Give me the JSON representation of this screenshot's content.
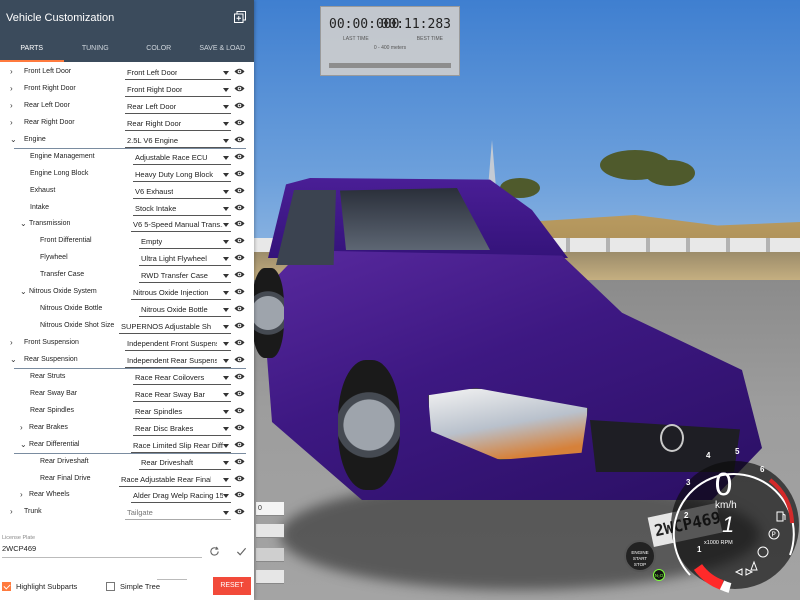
{
  "panel": {
    "title": "Vehicle Customization",
    "tabs": [
      {
        "label": "PARTS",
        "active": true
      },
      {
        "label": "TUNING",
        "active": false
      },
      {
        "label": "COLOR",
        "active": false
      },
      {
        "label": "SAVE & LOAD",
        "active": false
      }
    ],
    "accent": "#ff7a3d"
  },
  "parts": [
    {
      "label": "Front Left Door",
      "value": "Front Left Door"
    },
    {
      "label": "Front Right Door",
      "value": "Front Right Door"
    },
    {
      "label": "Rear Left Door",
      "value": "Rear Left Door"
    },
    {
      "label": "Rear Right Door",
      "value": "Rear Right Door"
    },
    {
      "label": "Engine",
      "value": "2.5L V6 Engine"
    },
    {
      "label": "Engine Management",
      "value": "Adjustable Race ECU"
    },
    {
      "label": "Engine Long Block",
      "value": "Heavy Duty Long Block"
    },
    {
      "label": "Exhaust",
      "value": "V6 Exhaust"
    },
    {
      "label": "Intake",
      "value": "Stock Intake"
    },
    {
      "label": "Transmission",
      "value": "V6 5-Speed Manual Trans..."
    },
    {
      "label": "Front Differential",
      "value": "Empty"
    },
    {
      "label": "Flywheel",
      "value": "Ultra Light Flywheel"
    },
    {
      "label": "Transfer Case",
      "value": "RWD Transfer Case"
    },
    {
      "label": "Nitrous Oxide System",
      "value": "Nitrous Oxide Injection"
    },
    {
      "label": "Nitrous Oxide Bottle",
      "value": "Nitrous Oxide Bottle"
    },
    {
      "label": "Nitrous Oxide Shot Size",
      "value": "SUPERNOS Adjustable Shot Size"
    },
    {
      "label": "Front Suspension",
      "value": "Independent Front Suspension"
    },
    {
      "label": "Rear Suspension",
      "value": "Independent Rear Suspension"
    },
    {
      "label": "Rear Struts",
      "value": "Race Rear Coilovers"
    },
    {
      "label": "Rear Sway Bar",
      "value": "Race Rear Sway Bar"
    },
    {
      "label": "Rear Spindles",
      "value": "Rear Spindles"
    },
    {
      "label": "Rear Brakes",
      "value": "Rear Disc Brakes"
    },
    {
      "label": "Rear Differential",
      "value": "Race Limited Slip Rear Diff..."
    },
    {
      "label": "Rear Driveshaft",
      "value": "Rear Driveshaft"
    },
    {
      "label": "Rear Final Drive",
      "value": "Race Adjustable Rear Final Drive"
    },
    {
      "label": "Rear Wheels",
      "value": "Alder Drag Welp Racing 15..."
    },
    {
      "label": "Trunk",
      "value": "Tailgate"
    }
  ],
  "license": {
    "label": "License Plate",
    "value": "2WCP469"
  },
  "options": {
    "highlight_subparts": {
      "label": "Highlight Subparts",
      "checked": true
    },
    "simple_tree": {
      "label": "Simple Tree",
      "checked": false
    },
    "reset_label": "RESET"
  },
  "strip": {
    "field_value": "0"
  },
  "timer": {
    "last_time": "00:00:000",
    "best_time": "00:11:283",
    "last_label": "LAST TIME",
    "best_label": "BEST TIME",
    "distance": "0 - 400 meters"
  },
  "dashboard": {
    "speed": "0",
    "speed_unit": "km/h",
    "gear": "1",
    "rpm_unit": "x1000 RPM",
    "rpm_ticks": [
      "1",
      "2",
      "3",
      "4",
      "5",
      "6"
    ],
    "start_button": [
      "ENGINE",
      "START",
      "STOP"
    ],
    "nos_badge": "N₂O"
  },
  "car": {
    "plate_text": "2WCP469",
    "paint": "#3d1882"
  }
}
